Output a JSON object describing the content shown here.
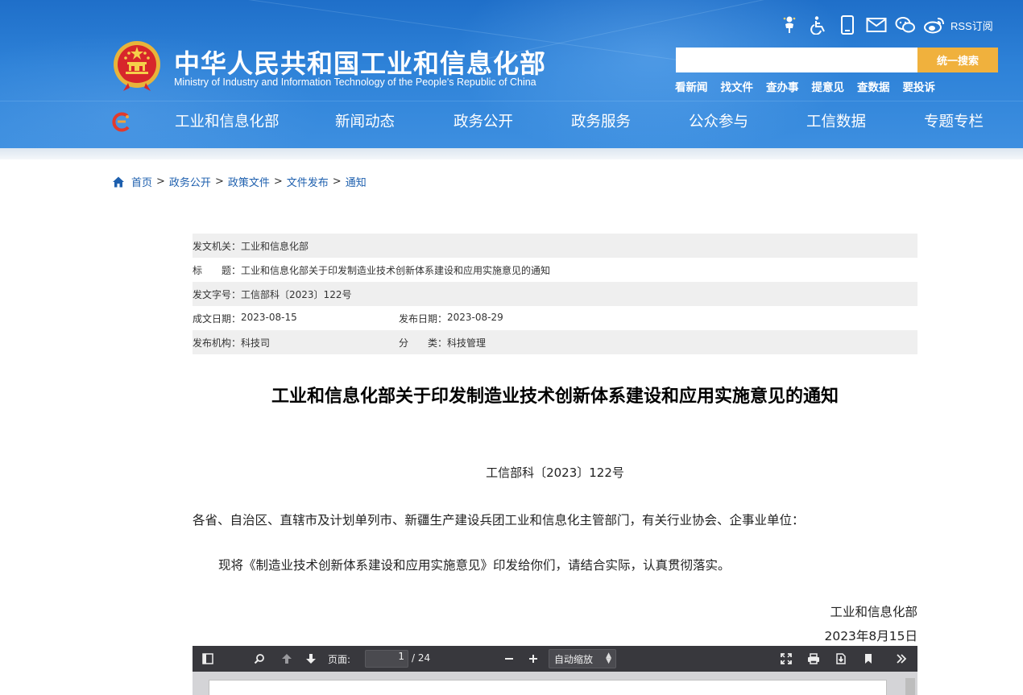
{
  "header": {
    "title_cn": "中华人民共和国工业和信息化部",
    "title_en": "Ministry of Industry and Information Technology of the People's Republic of China",
    "tools": [
      {
        "icon": "elderly-mode-icon"
      },
      {
        "icon": "accessibility-icon"
      },
      {
        "icon": "mobile-icon"
      },
      {
        "icon": "mail-icon"
      },
      {
        "icon": "wechat-icon"
      },
      {
        "icon": "weibo-icon"
      }
    ],
    "rss_label": "RSS订阅",
    "search": {
      "placeholder": "",
      "button_label": "统一搜索"
    },
    "quick_links": [
      "看新闻",
      "找文件",
      "查办事",
      "提意见",
      "查数据",
      "要投诉"
    ],
    "nav": [
      "工业和信息化部",
      "新闻动态",
      "政务公开",
      "政务服务",
      "公众参与",
      "工信数据",
      "专题专栏"
    ]
  },
  "breadcrumb": [
    "首页",
    "政务公开",
    "政策文件",
    "文件发布",
    "通知"
  ],
  "info": {
    "issuer_label": "发文机关：",
    "issuer": "工业和信息化部",
    "title_label": "标　　题：",
    "title": "工业和信息化部关于印发制造业技术创新体系建设和应用实施意见的通知",
    "docno_label": "发文字号：",
    "docno": "工信部科〔2023〕122号",
    "written_label": "成文日期：",
    "written": "2023-08-15",
    "published_label": "发布日期：",
    "published": "2023-08-29",
    "org_label": "发布机构：",
    "org": "科技司",
    "category_label": "分　　类：",
    "category": "科技管理"
  },
  "document": {
    "title": "工业和信息化部关于印发制造业技术创新体系建设和应用实施意见的通知",
    "number": "工信部科〔2023〕122号",
    "addressee": "各省、自治区、直辖市及计划单列市、新疆生产建设兵团工业和信息化主管部门，有关行业协会、企事业单位：",
    "body": "现将《制造业技术创新体系建设和应用实施意见》印发给你们，请结合实际，认真贯彻落实。",
    "signer": "工业和信息化部",
    "date": "2023年8月15日"
  },
  "pdf_viewer": {
    "page_label": "页面:",
    "current_page": "1",
    "total_pages": "/ 24",
    "zoom": "自动缩放"
  },
  "colors": {
    "header_blue": "#2e82d8",
    "search_button": "#f0b13d",
    "link_blue": "#1d5fae",
    "pdf_toolbar": "#38383d"
  }
}
